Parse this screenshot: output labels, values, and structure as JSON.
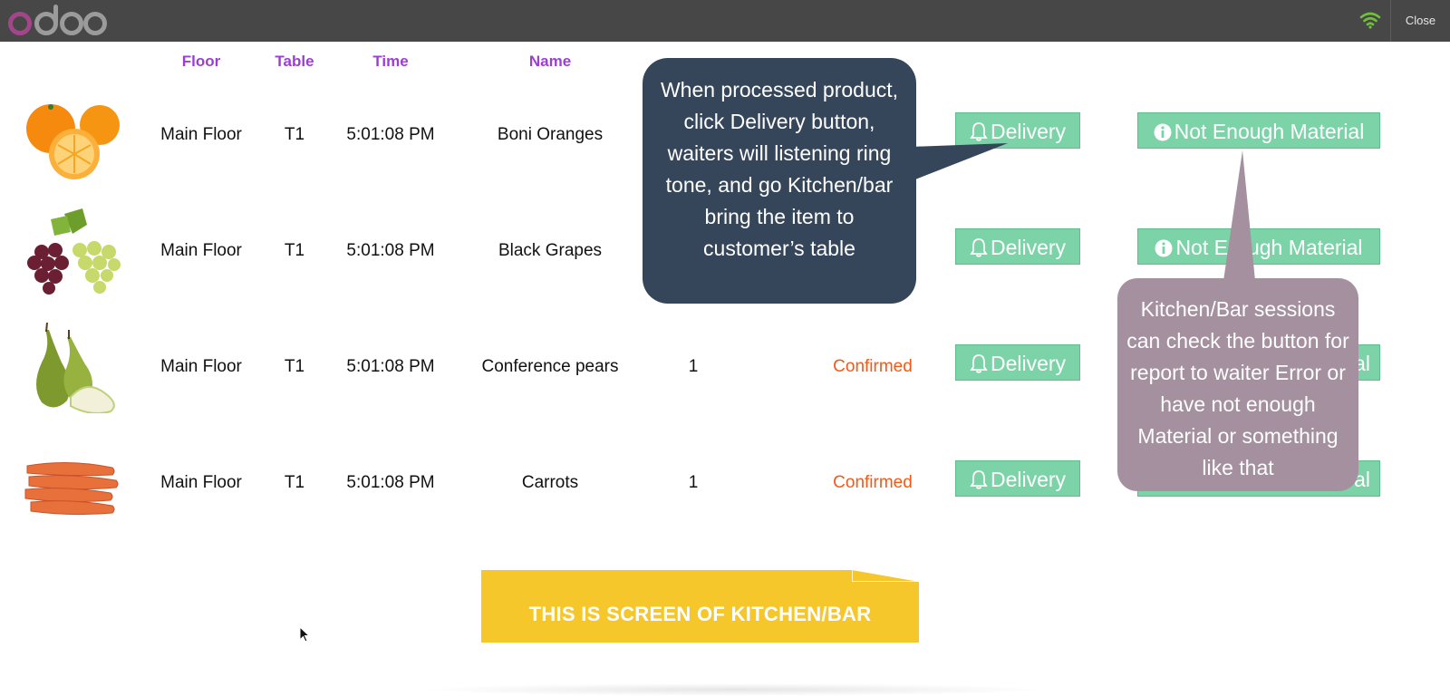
{
  "header": {
    "logo_text": "odoo",
    "close_label": "Close"
  },
  "columns": [
    "Floor",
    "Table",
    "Time",
    "Name"
  ],
  "rows": [
    {
      "image": "oranges-image",
      "floor": "Main Floor",
      "table": "T1",
      "time": "5:01:08 PM",
      "name": "Boni Oranges",
      "quantity": "",
      "status": ""
    },
    {
      "image": "grapes-image",
      "floor": "Main Floor",
      "table": "T1",
      "time": "5:01:08 PM",
      "name": "Black Grapes",
      "quantity": "",
      "status": ""
    },
    {
      "image": "pears-image",
      "floor": "Main Floor",
      "table": "T1",
      "time": "5:01:08 PM",
      "name": "Conference pears",
      "quantity": "1",
      "status": "Confirmed"
    },
    {
      "image": "carrots-image",
      "floor": "Main Floor",
      "table": "T1",
      "time": "5:01:08 PM",
      "name": "Carrots",
      "quantity": "1",
      "status": "Confirmed"
    }
  ],
  "buttons": {
    "delivery_label": "Delivery",
    "not_enough_label": "Not Enough Material",
    "row2_not_enough_visible": "Not E",
    "row2_not_enough_visible_end": "ugh Material",
    "row3_not_enough_visible": "al",
    "row4_not_enough_visible": "al"
  },
  "callouts": {
    "delivery_tip": "When processed product, click Delivery button, waiters will listening ring tone, and go Kitchen/bar bring the item to customer’s table",
    "material_tip": "Kitchen/Bar sessions can check the button for report to waiter Error or have not enough Material or something like that"
  },
  "banner": "THIS IS SCREEN OF KITCHEN/BAR",
  "colors": {
    "topbar": "#474747",
    "header_text": "#9c3ed6",
    "status": "#f15a16",
    "button": "#7dd3a8",
    "callout_dark": "#36465a",
    "callout_mauve": "#a4909e",
    "banner": "#f6c72a"
  }
}
